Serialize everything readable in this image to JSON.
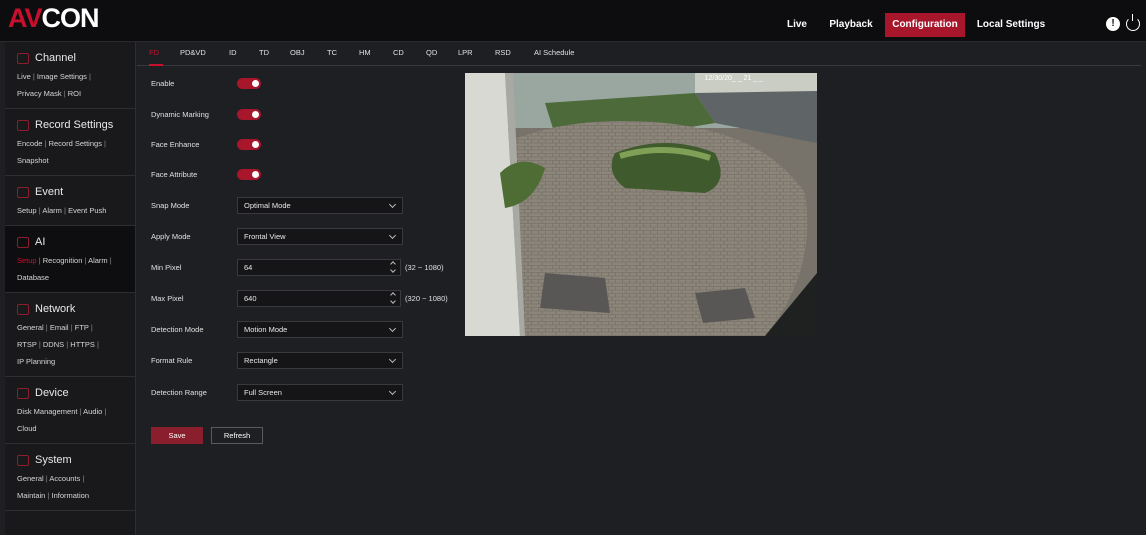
{
  "header": {
    "logo": {
      "left": "AV",
      "right": "CON"
    },
    "nav": [
      {
        "label": "Live"
      },
      {
        "label": "Playback"
      },
      {
        "label": "Configuration"
      },
      {
        "label": "Local Settings"
      }
    ],
    "alert_symbol": "!"
  },
  "sidebar": {
    "sections": [
      {
        "title": "Channel",
        "icon": "camera-icon",
        "links": [
          "Live",
          "Image Settings",
          "Privacy Mask",
          "ROI"
        ]
      },
      {
        "title": "Record Settings",
        "icon": "record-icon",
        "links": [
          "Encode",
          "Record Settings",
          "Snapshot"
        ]
      },
      {
        "title": "Event",
        "icon": "event-icon",
        "links": [
          "Setup",
          "Alarm",
          "Event Push"
        ]
      },
      {
        "title": "AI",
        "icon": "ai-icon",
        "links": [
          "Setup",
          "Recognition",
          "Alarm",
          "Database"
        ],
        "current_link": "Setup"
      },
      {
        "title": "Network",
        "icon": "network-icon",
        "links": [
          "General",
          "Email",
          "FTP",
          "RTSP",
          "DDNS",
          "HTTPS",
          "IP Planning"
        ]
      },
      {
        "title": "Device",
        "icon": "device-icon",
        "links": [
          "Disk Management",
          "Audio",
          "Cloud"
        ]
      },
      {
        "title": "System",
        "icon": "system-icon",
        "links": [
          "General",
          "Accounts",
          "Maintain",
          "Information"
        ]
      }
    ]
  },
  "tabs": [
    "FD",
    "PD&VD",
    "ID",
    "TD",
    "OBJ",
    "TC",
    "HM",
    "CD",
    "QD",
    "LPR",
    "RSD",
    "AI Schedule"
  ],
  "active_tab": "FD",
  "form": {
    "enable_label": "Enable",
    "enable_on": true,
    "dynamic_marking_label": "Dynamic Marking",
    "dynamic_marking_on": true,
    "face_enhance_label": "Face Enhance",
    "face_enhance_on": true,
    "face_attribute_label": "Face Attribute",
    "face_attribute_on": true,
    "snap_mode_label": "Snap Mode",
    "snap_mode_value": "Optimal Mode",
    "apply_mode_label": "Apply Mode",
    "apply_mode_value": "Frontal View",
    "min_pixel_label": "Min Pixel",
    "min_pixel_value": "64",
    "min_pixel_range": "(32 ~ 1080)",
    "max_pixel_label": "Max Pixel",
    "max_pixel_value": "640",
    "max_pixel_range": "(320 ~ 1080)",
    "detection_mode_label": "Detection Mode",
    "detection_mode_value": "Motion Mode",
    "format_rule_label": "Format Rule",
    "format_rule_value": "Rectangle",
    "detection_range_label": "Detection Range",
    "detection_range_value": "Full Screen",
    "save_label": "Save",
    "refresh_label": "Refresh"
  },
  "preview": {
    "timestamp": "12/30/20_ _ 21 _ _"
  },
  "colors": {
    "accent": "#c8102e",
    "button_red": "#8b1e2c",
    "nav_active": "#a8162b",
    "background": "#1e1f22"
  }
}
